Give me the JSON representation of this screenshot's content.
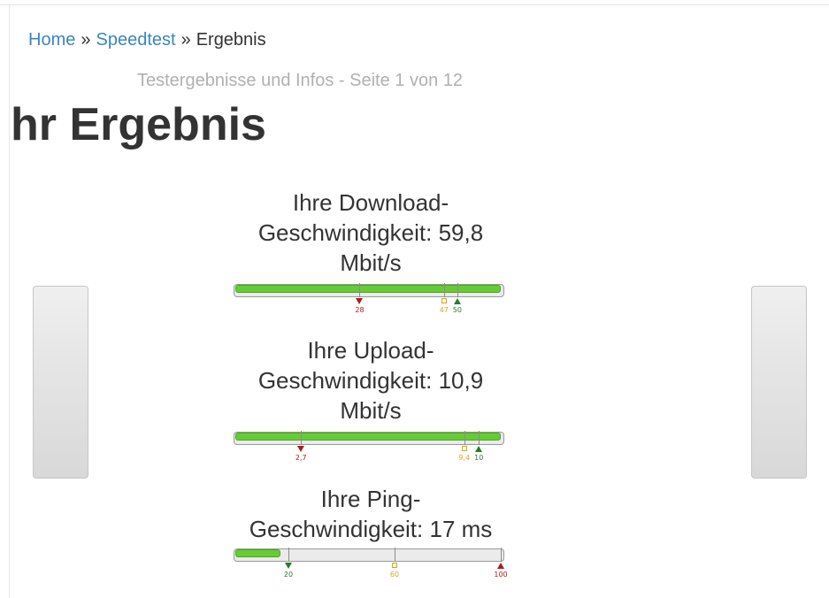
{
  "breadcrumb": {
    "home": "Home",
    "separator": "»",
    "speedtest": "Speedtest",
    "current": "Ergebnis"
  },
  "subtitle": "Testergebnisse und Infos - Seite 1 von 12",
  "title": "hr Ergebnis",
  "colors": {
    "link": "#3a86c2",
    "fill": "#66cc33",
    "marker_red": "#a81e1e",
    "marker_yellow": "#d9a520",
    "marker_green": "#2a7a2a"
  },
  "results": {
    "download": {
      "label": "Ihre Download-Geschwindigkeit: 59,8 Mbit/s",
      "value": 59.8,
      "scale_max": 59.8,
      "fill_fraction": 1.0,
      "markers": [
        {
          "value": 28,
          "text": "28",
          "kind": "red-down"
        },
        {
          "value": 47,
          "text": "47",
          "kind": "yellow-square"
        },
        {
          "value": 50,
          "text": "50",
          "kind": "green-up"
        }
      ]
    },
    "upload": {
      "label": "Ihre Upload-Geschwindigkeit: 10,9 Mbit/s",
      "value": 10.9,
      "scale_max": 10.9,
      "fill_fraction": 1.0,
      "markers": [
        {
          "value": 2.7,
          "text": "2,7",
          "kind": "red-down"
        },
        {
          "value": 9.4,
          "text": "9,4",
          "kind": "yellow-square"
        },
        {
          "value": 10,
          "text": "10",
          "kind": "green-up"
        }
      ]
    },
    "ping": {
      "label": "Ihre Ping-Geschwindigkeit: 17 ms",
      "value": 17,
      "scale_max": 100,
      "fill_fraction": 0.17,
      "markers": [
        {
          "value": 20,
          "text": "20",
          "kind": "green-down"
        },
        {
          "value": 60,
          "text": "60",
          "kind": "yellow-square"
        },
        {
          "value": 100,
          "text": "100",
          "kind": "red-up"
        }
      ]
    }
  }
}
